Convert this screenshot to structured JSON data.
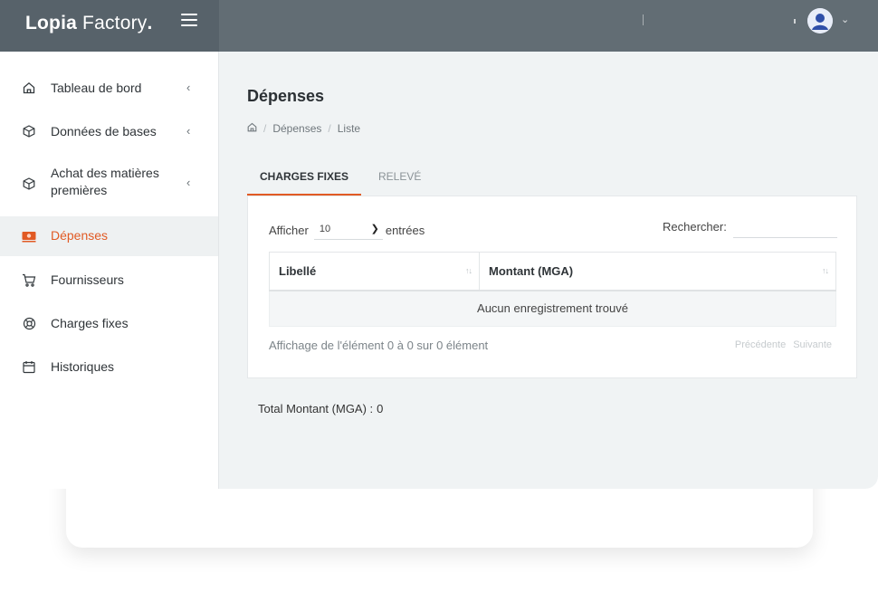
{
  "topbar": {
    "brand_bold": "Lopia",
    "brand_rest": "Factory",
    "brand_dot": ".",
    "accent": "#e15a24"
  },
  "sidebar": {
    "items": [
      {
        "label": "Tableau de bord",
        "icon": "home-icon",
        "has_submenu": true
      },
      {
        "label": "Données de bases",
        "icon": "box-icon",
        "has_submenu": true
      },
      {
        "label": "Achat des matières premières",
        "icon": "box-icon",
        "has_submenu": true
      },
      {
        "label": "Dépenses",
        "icon": "money-icon",
        "active": true
      },
      {
        "label": "Fournisseurs",
        "icon": "cart-icon"
      },
      {
        "label": "Charges fixes",
        "icon": "lifebuoy-icon"
      },
      {
        "label": "Historiques",
        "icon": "calendar-icon"
      }
    ]
  },
  "page": {
    "title": "Dépenses",
    "breadcrumb": [
      "Dépenses",
      "Liste"
    ]
  },
  "tabs": [
    {
      "label": "CHARGES FIXES",
      "active": true
    },
    {
      "label": "RELEVÉ",
      "active": false
    }
  ],
  "table_ctrl": {
    "show_label": "Afficher",
    "page_size": "10",
    "entries_label": "entrées",
    "search_label": "Rechercher:",
    "search_value": ""
  },
  "table": {
    "columns": [
      "Libellé",
      "Montant (MGA)"
    ],
    "empty_message": "Aucun enregistrement trouvé",
    "info": "Affichage de l'élément 0 à 0 sur 0 élément",
    "prev_label": "Précédente",
    "next_label": "Suivante"
  },
  "summary": {
    "total_label": "Total Montant (MGA) :",
    "total_value": "0"
  }
}
